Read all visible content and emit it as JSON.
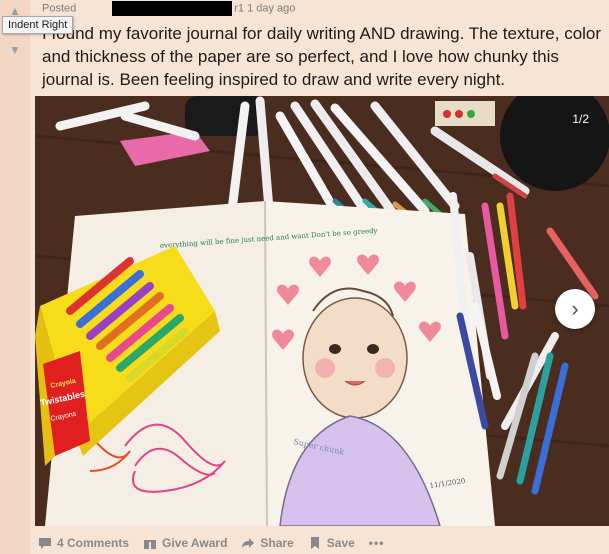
{
  "tooltip": "Indent Right",
  "post": {
    "posted_prefix": "Posted",
    "user_tail": "r1",
    "time": "1 day ago",
    "title": "I found my favorite journal for daily writing AND drawing. The texture, color and thickness of the paper are so perfect, and I love how chunky this journal is. Been feeling inspired to draw and write every night."
  },
  "gallery": {
    "counter": "1/2"
  },
  "artwork": {
    "journal_note": "everything will be fine just need and want Don't be so greedy",
    "shirt_text": "Super chunk",
    "signature": "11/1/2020",
    "crayon_brand": "Crayola",
    "crayon_product": "Twistables",
    "crayon_label": "Crayons"
  },
  "actions": {
    "comments": "4 Comments",
    "award": "Give Award",
    "share": "Share",
    "save": "Save",
    "more": "•••"
  },
  "icons": {
    "upvote": "arrow-up-icon",
    "downvote": "arrow-down-icon",
    "comments": "comment-icon",
    "award": "gift-icon",
    "share": "share-icon",
    "save": "bookmark-icon",
    "next": "chevron-right-icon"
  }
}
